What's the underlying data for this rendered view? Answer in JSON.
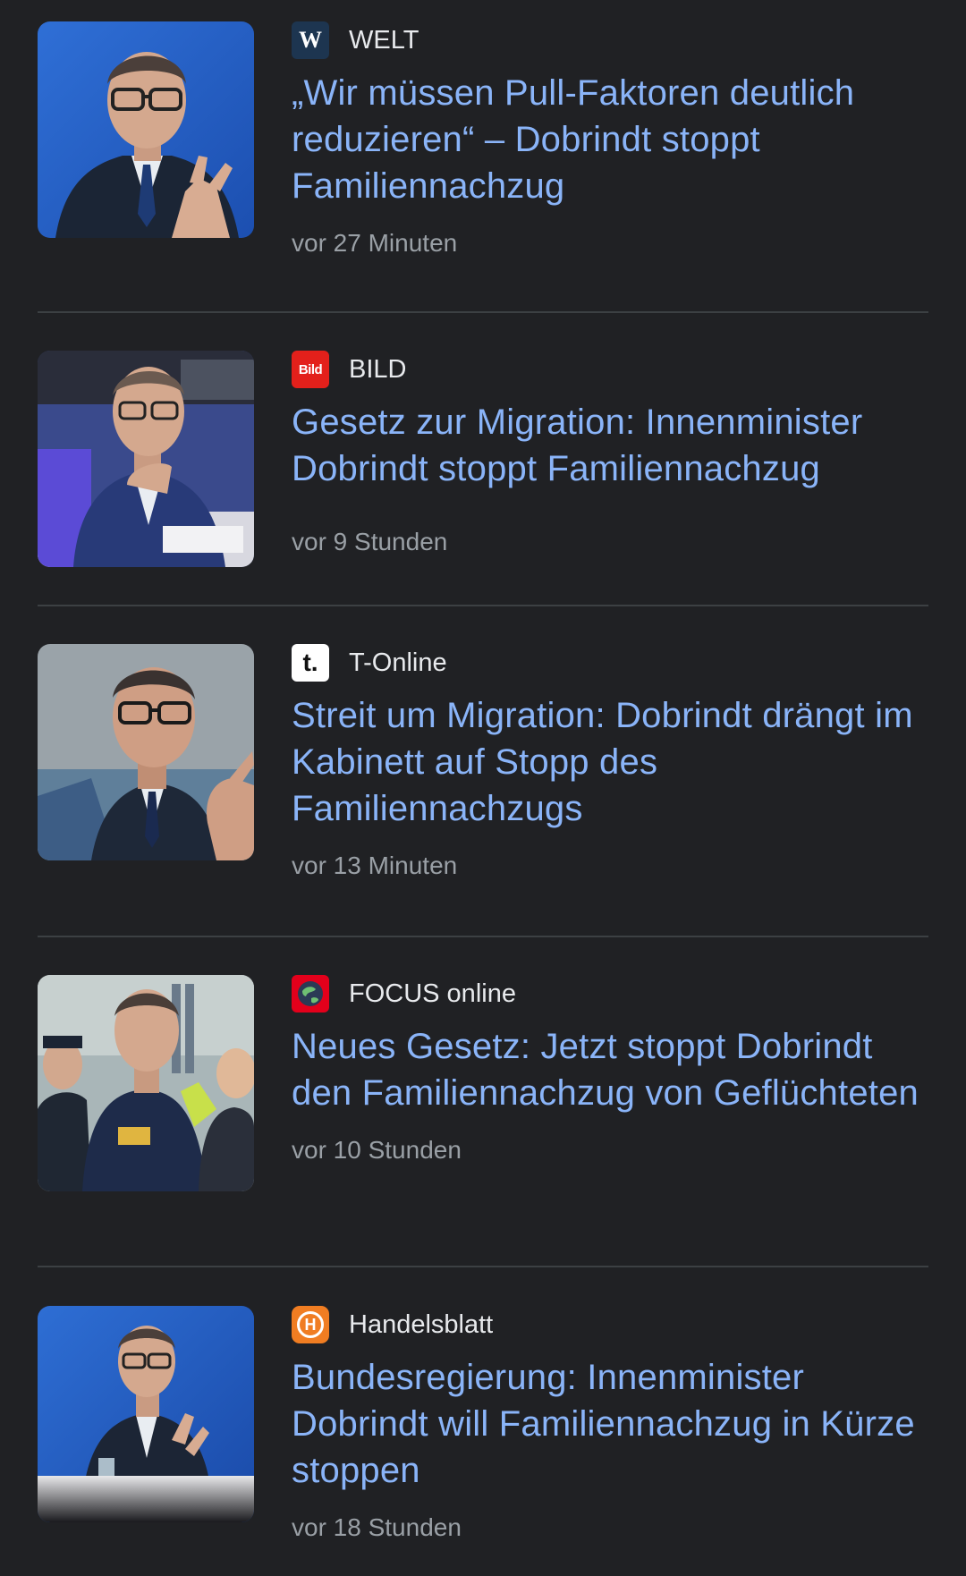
{
  "articles": [
    {
      "source": "WELT",
      "source_logo_icon": "welt-logo-icon",
      "headline": "„Wir müssen Pull-Faktoren deutlich reduzieren“ – Dobrindt stoppt Familiennachzug",
      "time": "vor 27 Minuten",
      "thumbnail_icon": "portrait-photo-icon"
    },
    {
      "source": "BILD",
      "source_logo_icon": "bild-logo-icon",
      "headline": "Gesetz zur Migration: Innenminister Dobrindt stoppt Familiennachzug",
      "time": "vor 9 Stunden",
      "thumbnail_icon": "portrait-photo-icon"
    },
    {
      "source": "T-Online",
      "source_logo_icon": "t-online-logo-icon",
      "headline": "Streit um Migration: Dobrindt drängt im Kabinett auf Stopp des Familiennachzugs",
      "time": "vor 13 Minuten",
      "thumbnail_icon": "portrait-photo-icon"
    },
    {
      "source": "FOCUS online",
      "source_logo_icon": "focus-logo-icon",
      "headline": "Neues Gesetz: Jetzt stoppt Dobrindt den Familiennachzug von Geflüchteten",
      "time": "vor 10 Stunden",
      "thumbnail_icon": "group-photo-icon"
    },
    {
      "source": "Handelsblatt",
      "source_logo_icon": "handelsblatt-logo-icon",
      "headline": "Bundesregierung: Innenminister Dobrindt will Familiennachzug in Kürze stoppen",
      "time": "vor 18 Stunden",
      "thumbnail_icon": "portrait-photo-icon"
    }
  ],
  "logo_text": {
    "welt": "W",
    "bild": "Bild",
    "t_online": "t.",
    "handelsblatt": "H"
  },
  "colors": {
    "background": "#202124",
    "headline": "#8ab4f8",
    "source_text": "#e8eaed",
    "time_text": "#9aa0a6",
    "divider": "#3c4043",
    "bild_red": "#e3201b",
    "t_online_pink": "#e20074",
    "focus_red": "#e3001b",
    "handelsblatt_orange": "#f07d22",
    "welt_navy": "#1d3550"
  }
}
